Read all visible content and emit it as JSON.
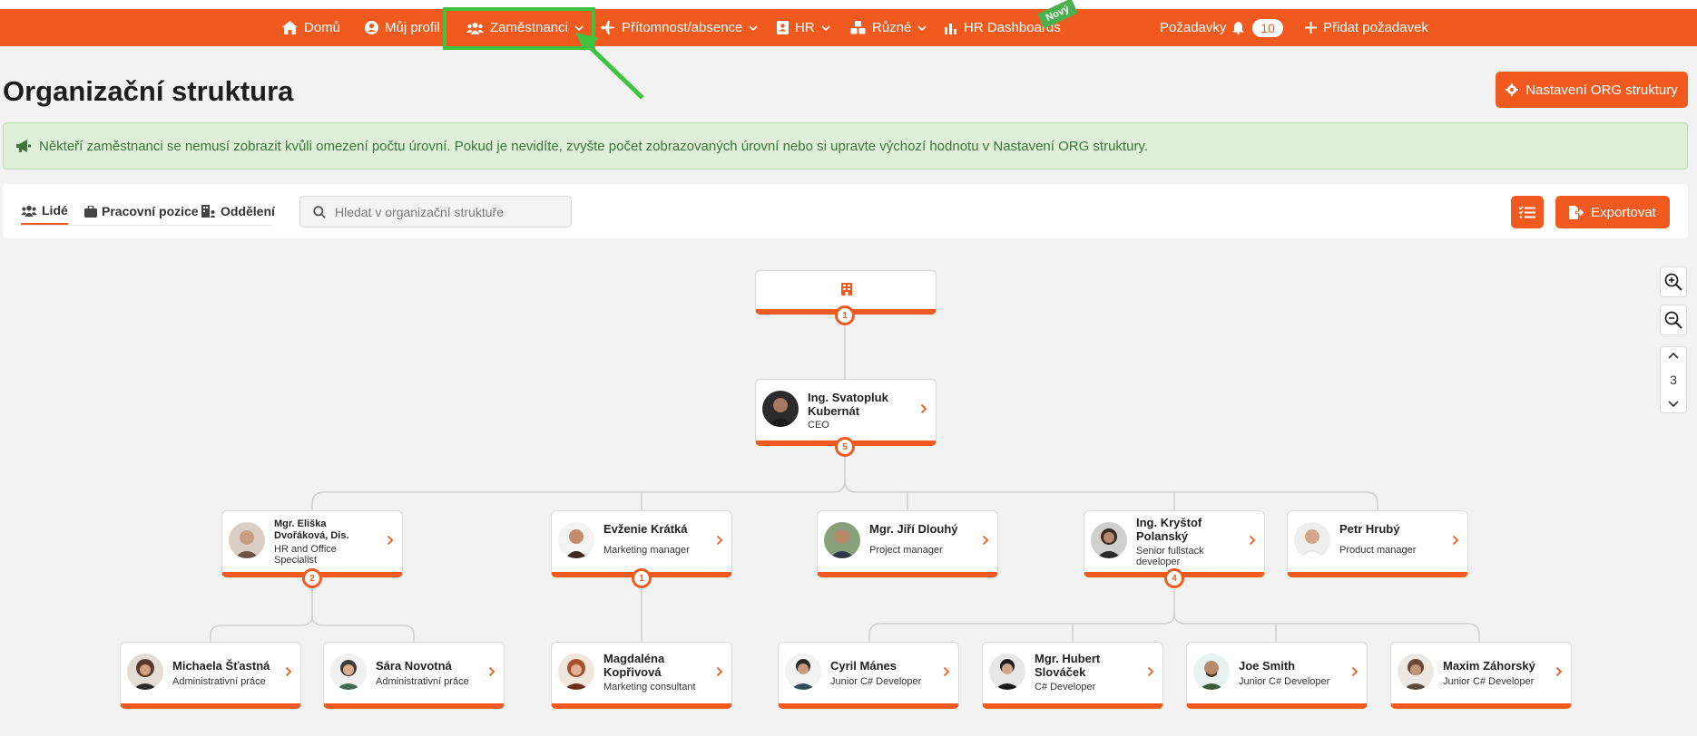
{
  "nav": {
    "home": "Domů",
    "profile": "Můj profil",
    "employees": "Zaměstnanci",
    "attendance": "Přítomnost/absence",
    "hr": "HR",
    "misc": "Různé",
    "dashboards": "HR Dashboards",
    "new_badge": "Nový",
    "requests": "Požadavky",
    "requests_count": "10",
    "add_request": "Přidat požadavek"
  },
  "page": {
    "title": "Organizační struktura",
    "settings_button": "Nastavení ORG struktury",
    "alert": "Někteří zaměstnanci se nemusí zobrazit kvůli omezení počtu úrovní. Pokud je nevidíte, zvyšte počet zobrazovaných úrovní nebo si upravte výchozí hodnotu v Nastavení ORG struktury."
  },
  "toolbar": {
    "tabs": [
      "Lidé",
      "Pracovní pozice",
      "Oddělení"
    ],
    "active_tab": "Lidé",
    "search_placeholder": "Hledat v organizační struktuře",
    "export_button": "Exportovat",
    "levels": "3"
  },
  "org": {
    "root_count": "1",
    "ceo": {
      "name": "Ing. Svatopluk Kubernát",
      "role": "CEO",
      "count": "5"
    },
    "level2": [
      {
        "name": "Mgr. Eliška Dvořáková, Dis.",
        "role": "HR and Office Specialist",
        "count": "2"
      },
      {
        "name": "Evženie Krátká",
        "role": "Marketing manager",
        "count": "1"
      },
      {
        "name": "Mgr. Jiří Dlouhý",
        "role": "Project manager"
      },
      {
        "name": "Ing. Kryštof Polanský",
        "role": "Senior fullstack developer",
        "count": "4"
      },
      {
        "name": "Petr Hrubý",
        "role": "Product manager"
      }
    ],
    "level3": [
      {
        "name": "Michaela Šťastná",
        "role": "Administrativní práce"
      },
      {
        "name": "Sára Novotná",
        "role": "Administrativní práce"
      },
      {
        "name": "Magdaléna Kopřivová",
        "role": "Marketing consultant"
      },
      {
        "name": "Cyril Mánes",
        "role": "Junior C# Developer"
      },
      {
        "name": "Mgr. Hubert Slováček",
        "role": "C# Developer"
      },
      {
        "name": "Joe Smith",
        "role": "Junior C# Developer"
      },
      {
        "name": "Maxim Záhorský",
        "role": "Junior C# Developer"
      }
    ]
  },
  "colors": {
    "accent": "#f15a1f",
    "highlight": "#3fc23f",
    "alert_bg": "#dff0d8"
  }
}
